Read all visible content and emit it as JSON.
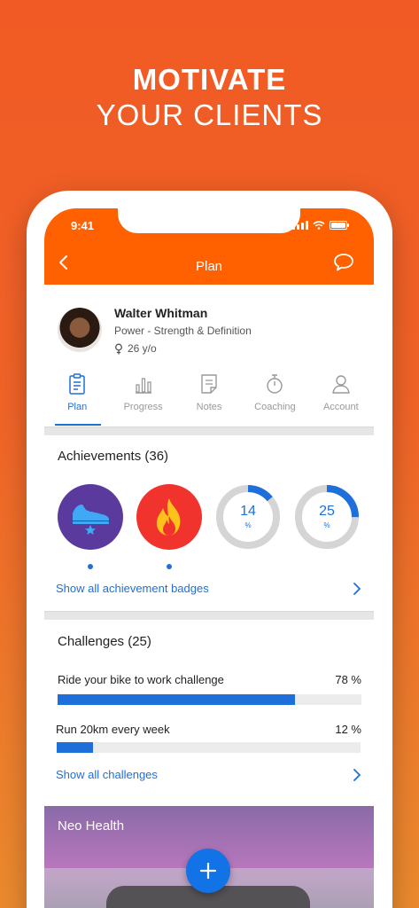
{
  "headline": {
    "line1": "MOTIVATE",
    "line2": "YOUR CLIENTS"
  },
  "status_bar": {
    "time": "9:41"
  },
  "nav": {
    "title": "Plan"
  },
  "profile": {
    "name": "Walter Whitman",
    "program": "Power - Strength & Definition",
    "age": "26 y/o"
  },
  "tabs": [
    {
      "label": "Plan",
      "icon": "clipboard-icon",
      "active": true
    },
    {
      "label": "Progress",
      "icon": "bar-chart-icon"
    },
    {
      "label": "Notes",
      "icon": "notes-icon"
    },
    {
      "label": "Coaching",
      "icon": "stopwatch-icon"
    },
    {
      "label": "Account",
      "icon": "user-icon"
    }
  ],
  "achievements": {
    "title": "Achievements (36)",
    "badges": [
      {
        "icon": "sneaker-star-icon",
        "color": "#5b3a9e"
      },
      {
        "icon": "flame-icon",
        "color": "#f1332e"
      },
      {
        "value": "14",
        "unit": "%",
        "progress": 0.14
      },
      {
        "value": "25",
        "unit": "%",
        "progress": 0.25
      }
    ],
    "link": "Show all achievement badges"
  },
  "challenges": {
    "title": "Challenges (25)",
    "items": [
      {
        "name": "Ride your bike to work challenge",
        "percent": "78 %",
        "progress": 0.78
      },
      {
        "name": "Run 20km every week",
        "percent": "12 %",
        "progress": 0.12
      }
    ],
    "link": "Show all challenges"
  },
  "card": {
    "title": "Neo Health"
  },
  "colors": {
    "accent": "#ff6000",
    "blue": "#1e6fd9"
  }
}
